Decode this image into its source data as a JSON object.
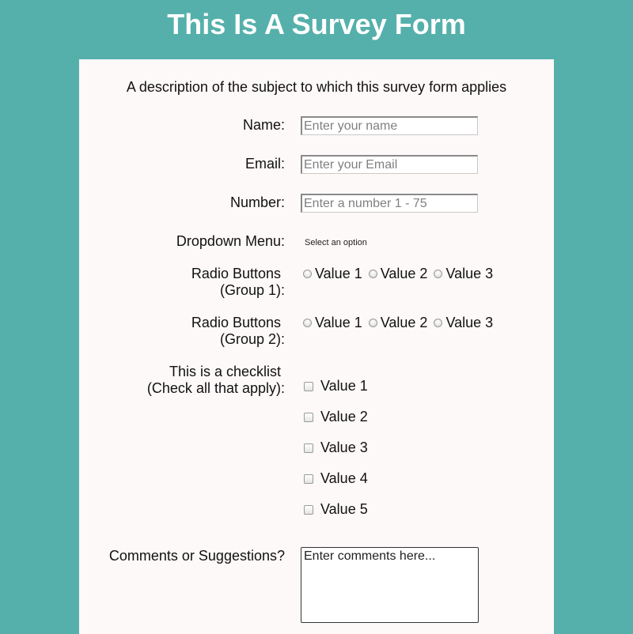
{
  "header": {
    "title": "This Is A Survey Form"
  },
  "form": {
    "description": "A description of the subject to which this survey form applies",
    "name": {
      "label": "Name:",
      "placeholder": "Enter your name"
    },
    "email": {
      "label": "Email:",
      "placeholder": "Enter your Email"
    },
    "number": {
      "label": "Number:",
      "placeholder": "Enter a number 1 - 75"
    },
    "dropdown": {
      "label": "Dropdown Menu:",
      "selected": "Select an option"
    },
    "radio_group_1": {
      "label_line1": "Radio Buttons",
      "label_line2": "(Group 1):",
      "options": [
        "Value 1",
        "Value 2",
        "Value 3"
      ]
    },
    "radio_group_2": {
      "label_line1": "Radio Buttons",
      "label_line2": "(Group 2):",
      "options": [
        "Value 1",
        "Value 2",
        "Value 3"
      ]
    },
    "checklist": {
      "label_line1": "This is a checklist",
      "label_line2": "(Check all that apply):",
      "options": [
        "Value 1",
        "Value 2",
        "Value 3",
        "Value 4",
        "Value 5"
      ]
    },
    "comments": {
      "label": "Comments or Suggestions?",
      "placeholder": "Enter comments here..."
    }
  },
  "colors": {
    "page_background": "#55b0ab",
    "card_background": "#fdf9f8",
    "title_text": "#ffffff"
  }
}
